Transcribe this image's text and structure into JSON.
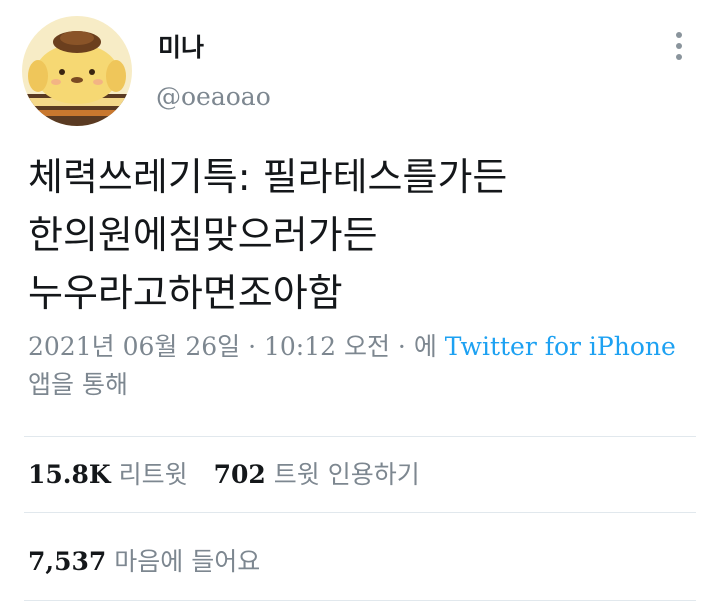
{
  "user": {
    "display_name": "미나",
    "handle": "@oeaoao",
    "avatar_icon": "pompompurin-avatar-icon"
  },
  "tweet": {
    "lines": [
      "체력쓰레기특: 필라테스를가든",
      "한의원에침맞으러가든",
      "누우라고하면조아함"
    ]
  },
  "meta": {
    "date": "2021년 06월 26일 · 10:12 오전 · 에 ",
    "source": "Twitter for iPhone",
    "via": "앱을 통해"
  },
  "stats": {
    "retweets_count": "15.8K",
    "retweets_label": "리트윗",
    "quotes_count": "702",
    "quotes_label": "트윗 인용하기",
    "likes_count": "7,537",
    "likes_label": "마음에 들어요"
  },
  "colors": {
    "link": "#1da1f2",
    "secondary_text": "#7d8790",
    "divider": "#e1e8ed"
  }
}
